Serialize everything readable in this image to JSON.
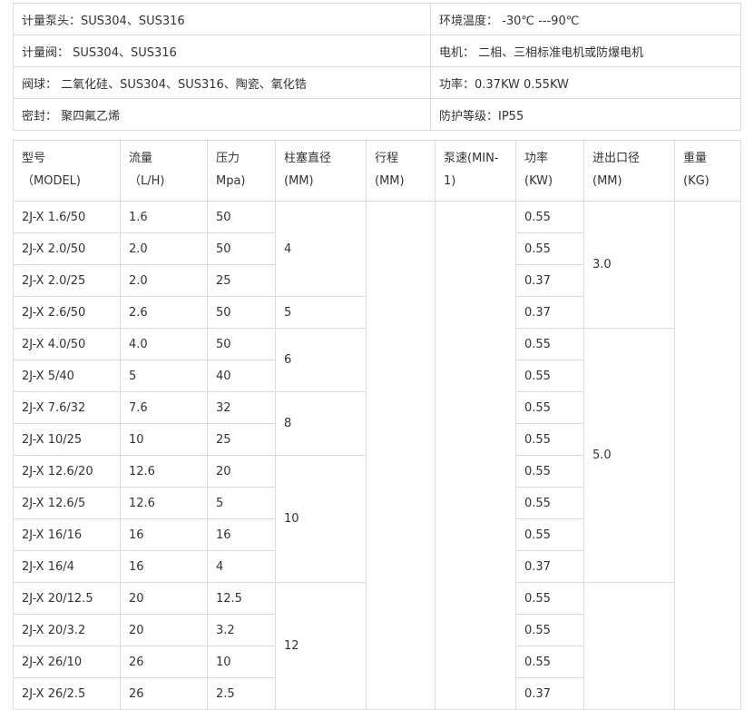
{
  "specs": [
    [
      "计量泵头：SUS304、SUS316",
      "环境温度： -30℃ ---90℃"
    ],
    [
      "计量阀： SUS304、SUS316",
      "电机： 二相、三相标准电机或防爆电机"
    ],
    [
      "阀球： 二氧化硅、SUS304、SUS316、陶瓷、氧化锆",
      "功率：0.37KW 0.55KW"
    ],
    [
      "密封： 聚四氟乙烯",
      "防护等级：IP55"
    ]
  ],
  "headers": [
    {
      "l1": "型号",
      "l2": "（MODEL)"
    },
    {
      "l1": "流量",
      "l2": "（L/H)"
    },
    {
      "l1": "压力",
      "l2": "Mpa)"
    },
    {
      "l1": "柱塞直径",
      "l2": "(MM)"
    },
    {
      "l1": "行程",
      "l2": "(MM)"
    },
    {
      "l1": "泵速(MIN-",
      "l2": "1)"
    },
    {
      "l1": "功率",
      "l2": "(KW)"
    },
    {
      "l1": "进出口径",
      "l2": "(MM)"
    },
    {
      "l1": "重量",
      "l2": "(KG)"
    }
  ],
  "rows": [
    [
      "2J-X 1.6/50",
      "1.6",
      "50",
      "0.55"
    ],
    [
      "2J-X 2.0/50",
      "2.0",
      "50",
      "0.55"
    ],
    [
      "2J-X 2.0/25",
      "2.0",
      "25",
      "0.37"
    ],
    [
      "2J-X 2.6/50",
      "2.6",
      "50",
      "0.37"
    ],
    [
      "2J-X 4.0/50",
      "4.0",
      "50",
      "0.55"
    ],
    [
      "2J-X 5/40",
      "5",
      "40",
      "0.55"
    ],
    [
      "2J-X 7.6/32",
      "7.6",
      "32",
      "0.55"
    ],
    [
      "2J-X 10/25",
      "10",
      "25",
      "0.55"
    ],
    [
      "2J-X 12.6/20",
      "12.6",
      "20",
      "0.55"
    ],
    [
      "2J-X 12.6/5",
      "12.6",
      "5",
      "0.55"
    ],
    [
      "2J-X 16/16",
      "16",
      "16",
      "0.55"
    ],
    [
      "2J-X 16/4",
      "16",
      "4",
      "0.37"
    ],
    [
      "2J-X 20/12.5",
      "20",
      "12.5",
      "0.55"
    ],
    [
      "2J-X 20/3.2",
      "20",
      "3.2",
      "0.55"
    ],
    [
      "2J-X 26/10",
      "26",
      "10",
      "0.55"
    ],
    [
      "2J-X 26/2.5",
      "26",
      "2.5",
      "0.37"
    ]
  ],
  "plunger_groups": [
    {
      "value": "4",
      "rows": 3
    },
    {
      "value": "5",
      "rows": 1
    },
    {
      "value": "6",
      "rows": 2
    },
    {
      "value": "8",
      "rows": 2
    },
    {
      "value": "10",
      "rows": 4
    },
    {
      "value": "12",
      "rows": 4
    }
  ],
  "port_groups": [
    {
      "value": "3.0",
      "rows": 4
    },
    {
      "value": "5.0",
      "rows": 8
    },
    {
      "value": "",
      "rows": 4
    }
  ]
}
